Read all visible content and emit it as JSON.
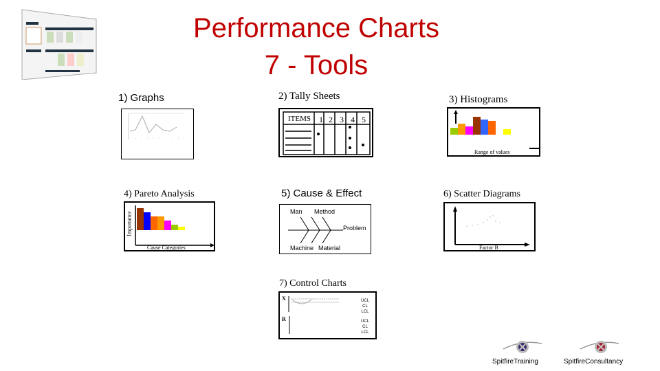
{
  "title": {
    "line1": "Performance Charts",
    "line2": "7 - Tools"
  },
  "sections": {
    "graphs": {
      "label": "1) Graphs"
    },
    "tally": {
      "label": "2) Tally Sheets",
      "header": [
        "ITEMS",
        "1",
        "2",
        "3",
        "4",
        "5"
      ]
    },
    "histograms": {
      "label": "3) Histograms",
      "xlabel": "Range of values",
      "colors": [
        "#99cc00",
        "#ff9900",
        "#ff00ff",
        "#993300",
        "#3366ff",
        "#ff6600",
        "#ffffff",
        "#ffff00"
      ]
    },
    "pareto": {
      "label": "4) Pareto Analysis",
      "ylabel": "Importance",
      "xlabel": "Cause Categories",
      "colors": [
        "#993300",
        "#0000ff",
        "#ff6600",
        "#ff9900",
        "#ff00ff",
        "#99cc00",
        "#ffff00"
      ]
    },
    "cause_effect": {
      "label": "5) Cause & Effect",
      "man": "Man",
      "method": "Method",
      "problem": "Problem",
      "machine": "Machine",
      "material": "Material"
    },
    "scatter": {
      "label": "6) Scatter Diagrams",
      "xlabel": "Factor B"
    },
    "control": {
      "label": "7) Control Charts",
      "x": "X",
      "r": "R",
      "limits": [
        "UCL",
        "CL",
        "LCL"
      ]
    }
  },
  "logos": {
    "training": "SpitfireTraining",
    "consultancy": "SpitfireConsultancy"
  }
}
